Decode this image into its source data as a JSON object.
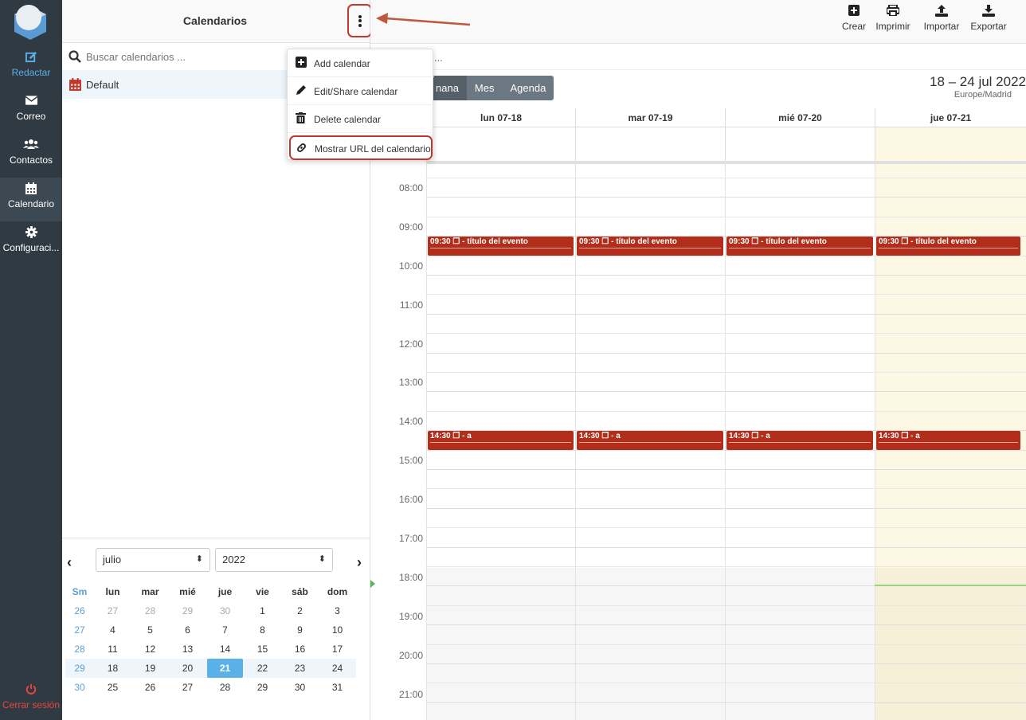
{
  "nav": {
    "items": [
      {
        "label": "Redactar",
        "icon": "compose-icon"
      },
      {
        "label": "Correo",
        "icon": "mail-icon"
      },
      {
        "label": "Contactos",
        "icon": "contacts-icon"
      },
      {
        "label": "Calendario",
        "icon": "calendar-icon"
      },
      {
        "label": "Configuraci...",
        "icon": "gear-icon"
      }
    ],
    "logout": "Cerrar sesión"
  },
  "sidebar": {
    "title": "Calendarios",
    "search_placeholder": "Buscar calendarios ...",
    "calendars": [
      {
        "name": "Default",
        "color": "#c0392b"
      }
    ]
  },
  "menu": {
    "items": [
      {
        "label": "Add calendar",
        "icon": "plus-square-icon"
      },
      {
        "label": "Edit/Share calendar",
        "icon": "pencil-icon"
      },
      {
        "label": "Delete calendar",
        "icon": "trash-icon"
      },
      {
        "label": "Mostrar URL del calendario",
        "icon": "link-icon"
      }
    ]
  },
  "toolbar": {
    "buttons": [
      {
        "label": "Crear",
        "icon": "plus-square-icon"
      },
      {
        "label": "Imprimir",
        "icon": "print-icon"
      },
      {
        "label": "Importar",
        "icon": "upload-icon"
      },
      {
        "label": "Exportar",
        "icon": "download-icon"
      }
    ]
  },
  "main": {
    "search_dots": "...",
    "views": [
      "nana",
      "Mes",
      "Agenda"
    ],
    "range_title": "18 – 24 jul 2022",
    "timezone": "Europe/Madrid",
    "days": [
      "lun 07-18",
      "mar 07-19",
      "mié 07-20",
      "jue 07-21"
    ],
    "hours": [
      "08:00",
      "09:00",
      "10:00",
      "11:00",
      "12:00",
      "13:00",
      "14:00",
      "15:00",
      "16:00",
      "17:00",
      "18:00",
      "19:00",
      "20:00",
      "21:00"
    ],
    "events_morning": {
      "time": "09:30",
      "title": "- título del evento"
    },
    "events_afternoon": {
      "time": "14:30",
      "title": "- a"
    }
  },
  "mini": {
    "month": "julio",
    "year": "2022",
    "headers": [
      "Sm",
      "lun",
      "mar",
      "mié",
      "jue",
      "vie",
      "sáb",
      "dom"
    ],
    "weeks": [
      [
        "26",
        "27",
        "28",
        "29",
        "30",
        "1",
        "2",
        "3"
      ],
      [
        "27",
        "4",
        "5",
        "6",
        "7",
        "8",
        "9",
        "10"
      ],
      [
        "28",
        "11",
        "12",
        "13",
        "14",
        "15",
        "16",
        "17"
      ],
      [
        "29",
        "18",
        "19",
        "20",
        "21",
        "22",
        "23",
        "24"
      ],
      [
        "30",
        "25",
        "26",
        "27",
        "28",
        "29",
        "30",
        "31"
      ]
    ],
    "today": "21"
  },
  "colors": {
    "event": "#b22d1a",
    "accent": "#5ab1e8",
    "nav_bg": "#2f3a43",
    "highlight": "#c0392b"
  }
}
